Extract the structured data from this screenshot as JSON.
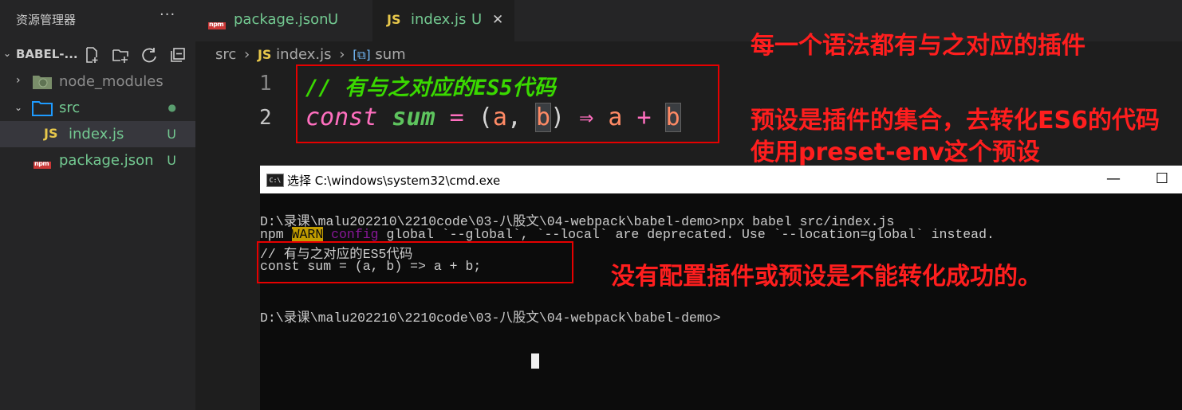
{
  "sidebar": {
    "title": "资源管理器",
    "more_label": "···",
    "section_title": "BABEL-...",
    "tree": [
      {
        "label": "node_modules",
        "status": ""
      },
      {
        "label": "src",
        "status": "●"
      },
      {
        "label": "index.js",
        "status": "U"
      },
      {
        "label": "package.json",
        "status": "U"
      }
    ]
  },
  "tabs": [
    {
      "label": "package.json",
      "status": "U"
    },
    {
      "label": "index.js",
      "status": "U",
      "close": "✕"
    }
  ],
  "breadcrumb": {
    "part1": "src",
    "sep": "›",
    "part2": "index.js",
    "part3": "sum"
  },
  "editor": {
    "lines": [
      {
        "num": "1",
        "comment": "// 有与之对应的ES5代码"
      },
      {
        "num": "2",
        "tokens": {
          "kw": "const",
          "name": "sum",
          "eq": "=",
          "open": "(",
          "a": "a",
          "comma": ",",
          "b": "b",
          "close": ")",
          "arrow": "⇒",
          "a2": "a",
          "plus": "+",
          "b2": "b"
        }
      }
    ]
  },
  "annotations": {
    "line1": "每一个语法都有与之对应的插件",
    "line2": "预设是插件的集合，去转化ES6的代码",
    "line3": "使用preset-env这个预设",
    "line4": "没有配置插件或预设是不能转化成功的。"
  },
  "cmd": {
    "title": "选择 C:\\windows\\system32\\cmd.exe",
    "icon_text": "C:\\",
    "minimize": "—",
    "maximize": "☐",
    "lines": {
      "l1": "D:\\录课\\malu202210\\2210code\\03-八股文\\04-webpack\\babel-demo>npx babel src/index.js",
      "l2_pre": "npm ",
      "l2_warn": "WARN",
      "l2_space": " ",
      "l2_config": "config",
      "l2_post": " global `--global`, `--local` are deprecated. Use `--location=global` instead.",
      "l3": "// 有与之对应的ES5代码",
      "l4": "const sum = (a, b) => a + b;",
      "l5": "D:\\录课\\malu202210\\2210code\\03-八股文\\04-webpack\\babel-demo>"
    }
  },
  "colors": {
    "accent_red": "#ff1e1e",
    "git_untracked": "#73c991",
    "js_yellow": "#e8c84b"
  }
}
